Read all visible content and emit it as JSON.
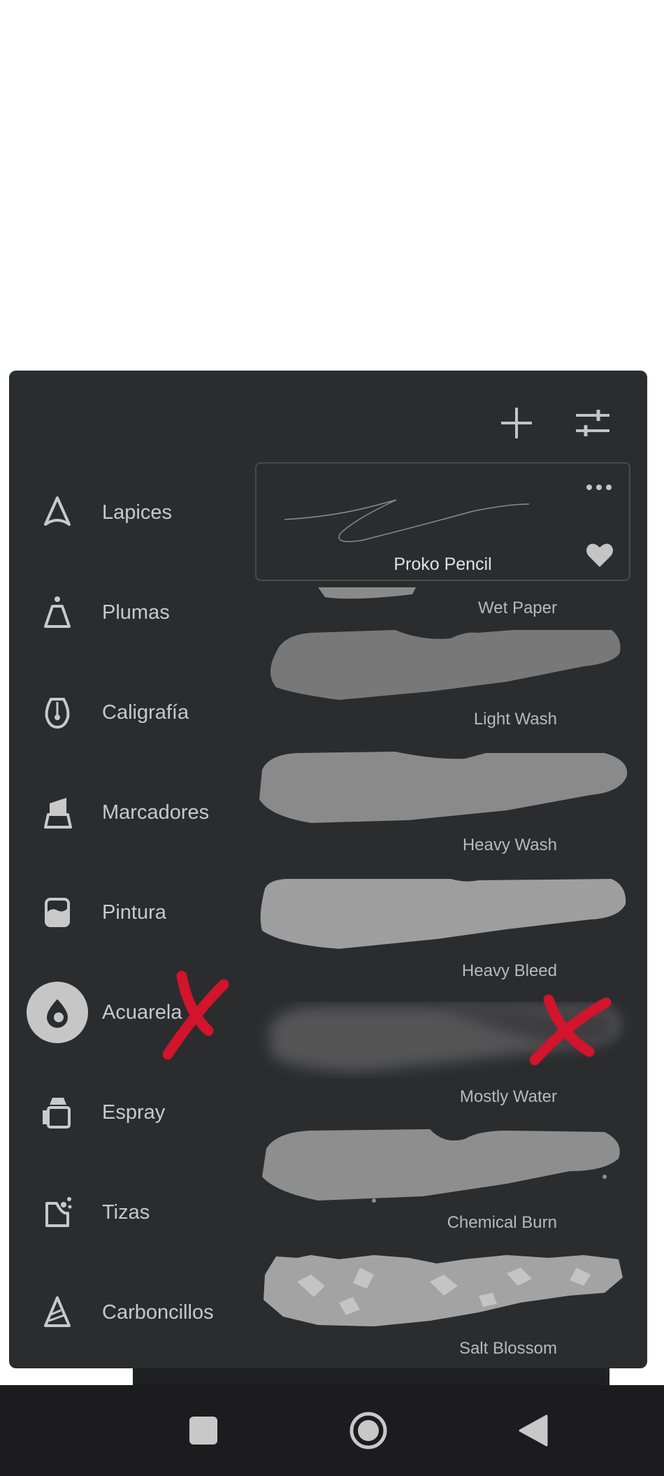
{
  "panel": {
    "add_icon": "plus-icon",
    "settings_icon": "sliders-icon",
    "categories": [
      {
        "label": "Lapices",
        "icon": "pencil-tip-icon"
      },
      {
        "label": "Plumas",
        "icon": "pen-nib-icon"
      },
      {
        "label": "Caligrafía",
        "icon": "calligraphy-nib-icon"
      },
      {
        "label": "Marcadores",
        "icon": "marker-icon"
      },
      {
        "label": "Pintura",
        "icon": "paint-pot-icon"
      },
      {
        "label": "Acuarela",
        "icon": "watercolor-drop-icon",
        "active": true
      },
      {
        "label": "Espray",
        "icon": "spray-can-icon"
      },
      {
        "label": "Tizas",
        "icon": "chalk-icon"
      },
      {
        "label": "Carboncillos",
        "icon": "charcoal-icon"
      }
    ],
    "selected_brush": {
      "name": "Proko Pencil",
      "more_icon": "more-horizontal-icon",
      "favorite_icon": "heart-icon"
    },
    "brushes": [
      {
        "name": "Wet Paper"
      },
      {
        "name": "Light Wash"
      },
      {
        "name": "Heavy Wash"
      },
      {
        "name": "Heavy Bleed"
      },
      {
        "name": "Mostly Water"
      },
      {
        "name": "Chemical Burn"
      },
      {
        "name": "Salt Blossom"
      }
    ]
  },
  "annotation_color": "#d2142c",
  "navbar": {
    "recents_icon": "square-icon",
    "home_icon": "circle-home-icon",
    "back_icon": "triangle-back-icon"
  }
}
